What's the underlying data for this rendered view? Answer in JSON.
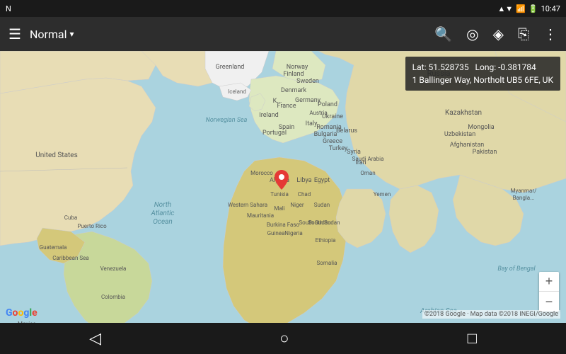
{
  "status_bar": {
    "left_icon": "N",
    "time": "10:47",
    "signal": "▲▼",
    "battery": "□"
  },
  "top_bar": {
    "menu_label": "Normal",
    "dropdown_arrow": "▾",
    "search_icon": "🔍",
    "location_icon": "⊕",
    "route_icon": "◆",
    "share_icon": "⋈",
    "more_icon": "⋮"
  },
  "info_box": {
    "lat_label": "Lat:",
    "lat_value": "51.528735",
    "long_label": "Long:",
    "long_value": "-0.381784",
    "address": "1 Ballinger Way, Northolt UB5 6FE, UK"
  },
  "zoom_controls": {
    "plus": "+",
    "minus": "−"
  },
  "attribution": "©2018 Google · Map data ©2018 INEGI/Google",
  "google_logo": "Google",
  "nav_bar": {
    "back": "◁",
    "home": "○",
    "recents": "□"
  }
}
